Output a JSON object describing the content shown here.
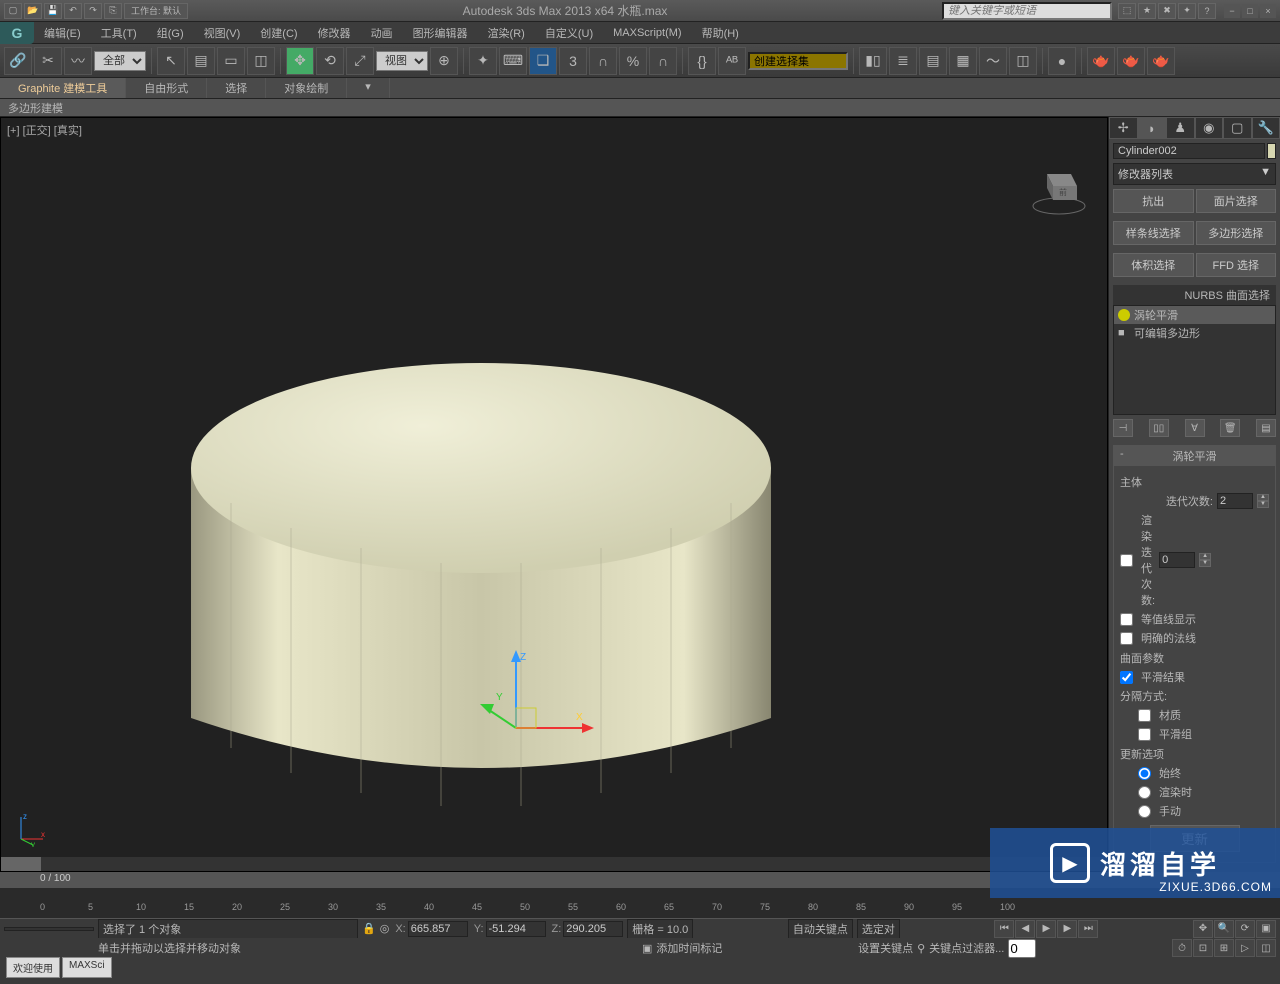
{
  "titlebar": {
    "workspace_label": "工作台: 默认",
    "title": "Autodesk 3ds Max  2013 x64     水瓶.max",
    "search_placeholder": "键入关键字或短语"
  },
  "menu": {
    "items": [
      "编辑(E)",
      "工具(T)",
      "组(G)",
      "视图(V)",
      "创建(C)",
      "修改器",
      "动画",
      "图形编辑器",
      "渲染(R)",
      "自定义(U)",
      "MAXScript(M)",
      "帮助(H)"
    ]
  },
  "toolbar": {
    "filter": "全部",
    "refcoord": "视图",
    "named_sel": "创建选择集"
  },
  "ribbon": {
    "tabs": [
      "Graphite 建模工具",
      "自由形式",
      "选择",
      "对象绘制"
    ],
    "sub": "多边形建模"
  },
  "viewport": {
    "label": "[+] [正交] [真实]"
  },
  "cmdpanel": {
    "object_name": "Cylinder002",
    "modlist_label": "修改器列表",
    "row1": [
      "抗出",
      "面片选择"
    ],
    "row2": [
      "样条线选择",
      "多边形选择"
    ],
    "row3": [
      "体积选择",
      "FFD 选择"
    ],
    "nurbs_label": "NURBS 曲面选择",
    "stack": [
      "涡轮平滑",
      "可编辑多边形"
    ],
    "rollout_title": "涡轮平滑",
    "main_group": "主体",
    "iterations_label": "迭代次数:",
    "iterations_value": "2",
    "render_iter_label": "渲染迭代次数:",
    "render_iter_value": "0",
    "isoline_label": "等值线显示",
    "explicit_label": "明确的法线",
    "surface_group": "曲面参数",
    "smooth_result": "平滑结果",
    "separate_by": "分隔方式:",
    "material_label": "材质",
    "smoothgroup_label": "平滑组",
    "update_group": "更新选项",
    "always": "始终",
    "render": "渲染时",
    "manual": "手动",
    "update_btn": "更新"
  },
  "timeline": {
    "range": "0 / 100",
    "ticks": [
      "0",
      "5",
      "10",
      "15",
      "20",
      "25",
      "30",
      "35",
      "40",
      "45",
      "50",
      "55",
      "60",
      "65",
      "70",
      "75",
      "80",
      "85",
      "90",
      "95",
      "100"
    ]
  },
  "status": {
    "selected": "选择了 1 个对象",
    "hint": "单击并拖动以选择并移动对象",
    "x_label": "X:",
    "x_val": "665.857",
    "y_label": "Y:",
    "y_val": "-51.294",
    "z_label": "Z:",
    "z_val": "290.205",
    "grid": "栅格 = 10.0",
    "autokey": "自动关键点",
    "selset": "选定对",
    "setkey": "设置关键点",
    "keyfilter": "关键点过滤器...",
    "addtimetag": "添加时间标记",
    "welcome1": "欢迎使用",
    "welcome2": "MAXSci"
  },
  "watermark": {
    "text": "溜溜自学",
    "url": "ZIXUE.3D66.COM"
  }
}
